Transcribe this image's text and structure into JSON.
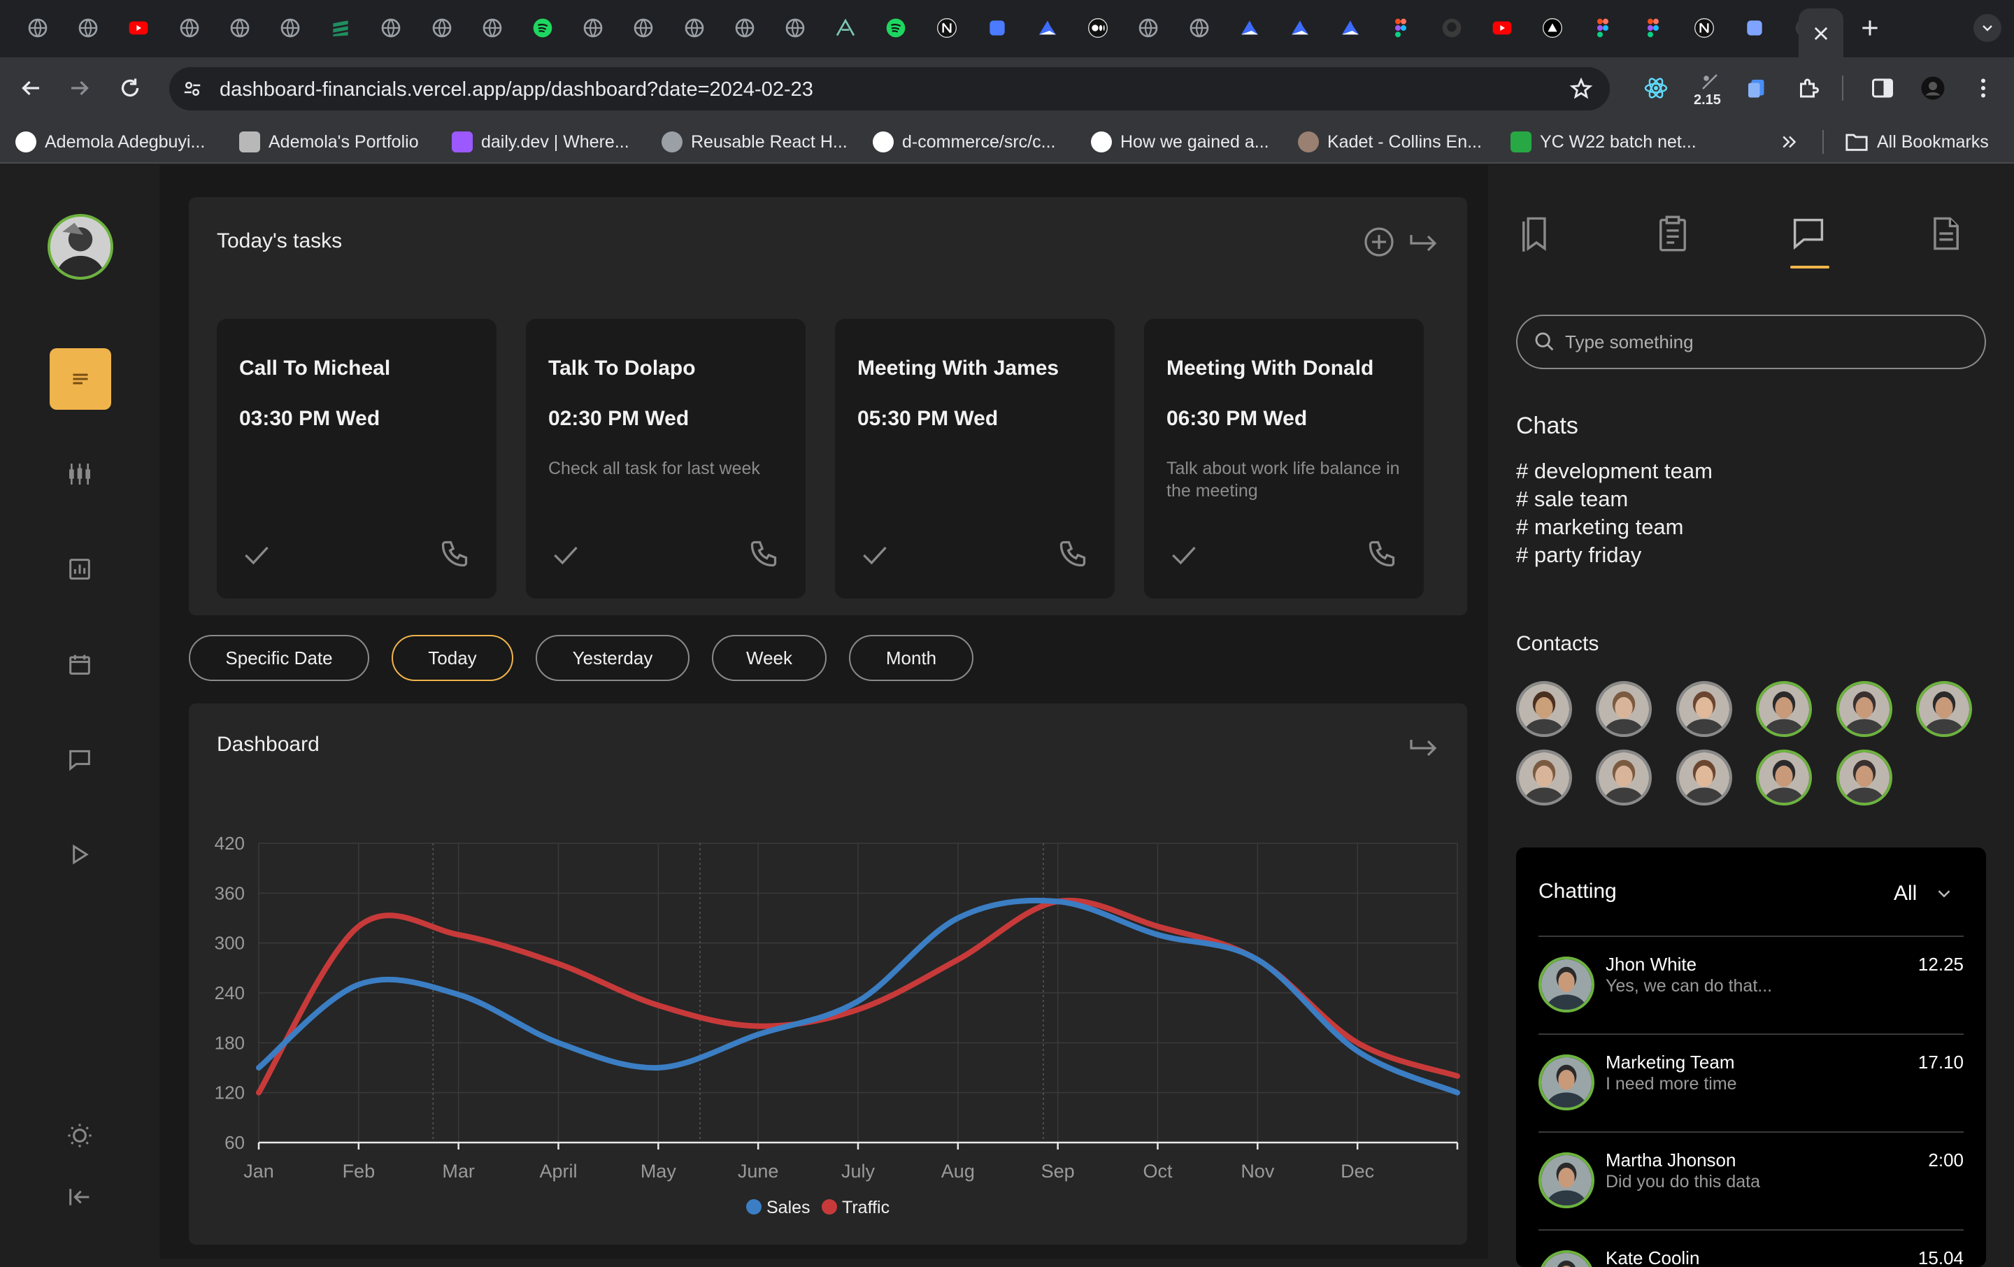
{
  "browser": {
    "url": "dashboard-financials.vercel.app/app/dashboard?date=2024-02-23",
    "extension_badge": "2.15",
    "tab_icons": [
      "globe",
      "globe",
      "youtube",
      "globe",
      "globe",
      "globe",
      "stack",
      "globe",
      "globe",
      "globe",
      "spotify",
      "globe",
      "globe",
      "globe",
      "globe",
      "globe",
      "triangle-a",
      "spotify",
      "notion",
      "ms",
      "vercel-plane",
      "medium",
      "globe",
      "split",
      "vercel-plane",
      "vercel-plane",
      "vercel-plane",
      "figma",
      "github",
      "youtube",
      "vercel",
      "figma",
      "figma",
      "notion",
      "loop",
      "github"
    ],
    "bookmarks": [
      {
        "label": "Ademola Adegbuyi...",
        "icon": "medium-icon",
        "color": "#ffffff"
      },
      {
        "label": "Ademola's Portfolio",
        "icon": "portfolio-icon",
        "color": "#b8b8b8"
      },
      {
        "label": "daily.dev | Where...",
        "icon": "dailydev-icon",
        "color": "#9b59ff"
      },
      {
        "label": "Reusable React H...",
        "icon": "globe-icon",
        "color": "#9aa0a6"
      },
      {
        "label": "d-commerce/src/c...",
        "icon": "github-icon",
        "color": "#ffffff"
      },
      {
        "label": "How we gained a...",
        "icon": "medium-icon",
        "color": "#ffffff"
      },
      {
        "label": "Kadet - Collins En...",
        "icon": "avatar-icon",
        "color": "#9a8070"
      },
      {
        "label": "YC W22 batch net...",
        "icon": "techcrunch-icon",
        "color": "#27a844"
      }
    ],
    "all_bookmarks": "All Bookmarks"
  },
  "tasks": {
    "title": "Today's tasks",
    "items": [
      {
        "title": "Call To Micheal",
        "time": "03:30 PM Wed",
        "note": ""
      },
      {
        "title": "Talk To Dolapo",
        "time": "02:30 PM Wed",
        "note": "Check all task for last week"
      },
      {
        "title": "Meeting With James",
        "time": "05:30 PM Wed",
        "note": ""
      },
      {
        "title": "Meeting With Donald",
        "time": "06:30 PM Wed",
        "note": "Talk about work life balance in the meeting"
      }
    ]
  },
  "filters": [
    {
      "label": "Specific Date",
      "active": false
    },
    {
      "label": "Today",
      "active": true
    },
    {
      "label": "Yesterday",
      "active": false
    },
    {
      "label": "Week",
      "active": false
    },
    {
      "label": "Month",
      "active": false
    }
  ],
  "dashboard": {
    "title": "Dashboard"
  },
  "chart_data": {
    "type": "line",
    "title": "",
    "xlabel": "",
    "ylabel": "",
    "categories": [
      "Jan",
      "Feb",
      "Mar",
      "April",
      "May",
      "June",
      "July",
      "Aug",
      "Sep",
      "Oct",
      "Nov",
      "Dec"
    ],
    "yticks": [
      60,
      120,
      180,
      240,
      300,
      360,
      420
    ],
    "ylim": [
      60,
      420
    ],
    "series": [
      {
        "name": "Sales",
        "color": "#3b7ec4",
        "values": [
          150,
          250,
          238,
          180,
          150,
          190,
          230,
          330,
          350,
          310,
          280,
          170,
          120
        ]
      },
      {
        "name": "Traffic",
        "color": "#c83a3a",
        "values": [
          120,
          320,
          310,
          275,
          225,
          200,
          220,
          280,
          350,
          320,
          280,
          180,
          140
        ]
      }
    ],
    "legend": "bottom",
    "grid": true
  },
  "right": {
    "search_placeholder": "Type something",
    "chats_title": "Chats",
    "channels": [
      "# development team",
      "# sale team",
      "# marketing team",
      "# party friday"
    ],
    "contacts_title": "Contacts",
    "contacts": [
      {
        "border": "#8a8a8a",
        "skin": "#c9a07a",
        "hair": "#4a3020"
      },
      {
        "border": "#8a8a8a",
        "skin": "#d8b59a",
        "hair": "#7a5a40"
      },
      {
        "border": "#8a8a8a",
        "skin": "#e0b89a",
        "hair": "#6a4530"
      },
      {
        "border": "#6db33f",
        "skin": "#c89a7a",
        "hair": "#2a2a2a"
      },
      {
        "border": "#6db33f",
        "skin": "#c89a7a",
        "hair": "#3a3030"
      },
      {
        "border": "#6db33f",
        "skin": "#c89a7a",
        "hair": "#2a2a2a"
      },
      {
        "border": "#8a8a8a",
        "skin": "#d8b59a",
        "hair": "#7a5a40"
      },
      {
        "border": "#8a8a8a",
        "skin": "#d8b59a",
        "hair": "#7a5a40"
      },
      {
        "border": "#8a8a8a",
        "skin": "#e0b89a",
        "hair": "#6a4530"
      },
      {
        "border": "#6db33f",
        "skin": "#c89a7a",
        "hair": "#2a2a2a"
      },
      {
        "border": "#6db33f",
        "skin": "#c89a7a",
        "hair": "#3a3030"
      }
    ],
    "chatting": {
      "title": "Chatting",
      "filter": "All",
      "rows": [
        {
          "name": "Jhon White",
          "message": "Yes, we can do that...",
          "time": "12.25"
        },
        {
          "name": "Marketing Team",
          "message": "I need more time",
          "time": "17.10"
        },
        {
          "name": "Martha Jhonson",
          "message": "Did you do this data",
          "time": "2:00"
        },
        {
          "name": "Kate Coolin",
          "message": "",
          "time": "15.04"
        }
      ]
    }
  },
  "colors": {
    "accent": "#f0b44c",
    "sales": "#3b7ec4",
    "traffic": "#c83a3a",
    "online": "#6db33f"
  }
}
